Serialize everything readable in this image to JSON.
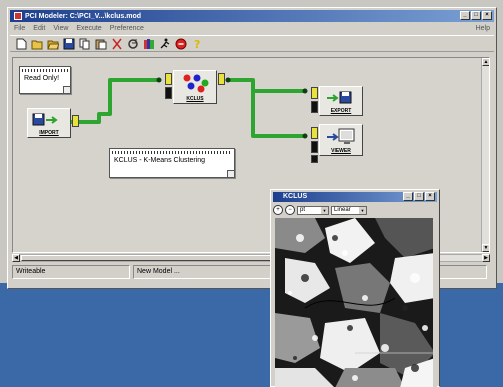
{
  "main_window": {
    "title": "PCI Modeler: C:\\PCI_V...\\kclus.mod",
    "controls": [
      "_",
      "□",
      "×"
    ]
  },
  "menu": {
    "items": [
      "File",
      "Edit",
      "View",
      "Execute",
      "Preference"
    ],
    "help": "Help"
  },
  "toolbar": {
    "icons": [
      "new-icon",
      "open-icon",
      "open-folder-icon",
      "save-icon",
      "copy-icon",
      "paste-icon",
      "cut-icon",
      "refresh-icon",
      "library-icon",
      "run-icon",
      "stop-icon",
      "help-icon"
    ]
  },
  "notes": {
    "read_only": "Read Only!",
    "kclus": "KCLUS - K-Means Clustering"
  },
  "modules": {
    "import": "IMPORT",
    "kclus": "KCLUS",
    "export": "EXPORT",
    "viewer": "VIEWER"
  },
  "status": {
    "mode": "Writeable",
    "message": "New Model ..."
  },
  "viewer_window": {
    "title": "KCLUS",
    "zoom_value": "pt",
    "stretch": "Linear",
    "controls": [
      "_",
      "□",
      "×"
    ]
  },
  "colors": {
    "titlebar": "#1d3f8e",
    "connector": "#2ea531",
    "desktop": "#3b69a7"
  }
}
